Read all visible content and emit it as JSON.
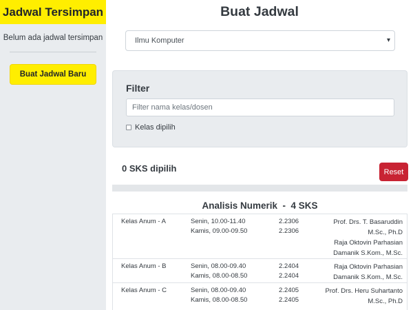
{
  "sidebar": {
    "title": "Jadwal Tersimpan",
    "empty_text": "Belum ada jadwal tersimpan",
    "new_button": "Buat Jadwal Baru"
  },
  "main": {
    "title": "Buat Jadwal",
    "program_select": {
      "value": "Ilmu Komputer"
    },
    "filter": {
      "title": "Filter",
      "placeholder": "Filter nama kelas/dosen",
      "checkbox_label": "Kelas dipilih"
    },
    "sks_text": "0 SKS dipilih",
    "reset_button": "Reset",
    "course": {
      "title": "Analisis Numerik  -  4 SKS",
      "classes": [
        {
          "name": "Kelas Anum - A",
          "times": [
            "Senin, 10.00-11.40",
            "Kamis, 09.00-09.50"
          ],
          "rooms": [
            "2.2306",
            "2.2306"
          ],
          "lecturers": [
            "Prof. Drs. T. Basaruddin M.Sc., Ph.D",
            "Raja Oktovin Parhasian Damanik S.Kom., M.Sc."
          ]
        },
        {
          "name": "Kelas Anum - B",
          "times": [
            "Senin, 08.00-09.40",
            "Kamis, 08.00-08.50"
          ],
          "rooms": [
            "2.2404",
            "2.2404"
          ],
          "lecturers": [
            "Raja Oktovin Parhasian Damanik S.Kom., M.Sc."
          ]
        },
        {
          "name": "Kelas Anum - C",
          "times": [
            "Senin, 08.00-09.40",
            "Kamis, 08.00-08.50"
          ],
          "rooms": [
            "2.2405",
            "2.2405"
          ],
          "lecturers": [
            "Prof. Drs. Heru Suhartanto M.Sc., Ph.D"
          ]
        }
      ]
    }
  }
}
